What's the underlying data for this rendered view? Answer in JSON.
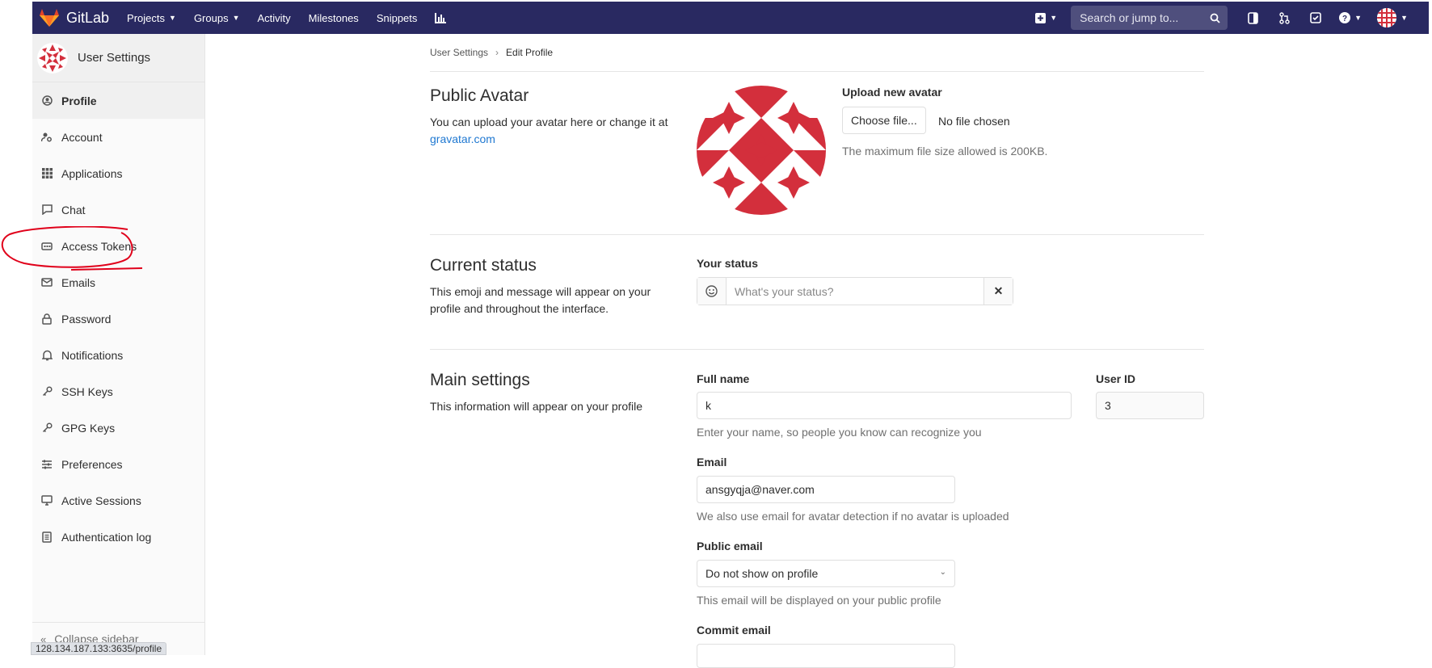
{
  "navbar": {
    "brand": "GitLab",
    "links": [
      {
        "label": "Projects",
        "dropdown": true
      },
      {
        "label": "Groups",
        "dropdown": true
      },
      {
        "label": "Activity"
      },
      {
        "label": "Milestones"
      },
      {
        "label": "Snippets"
      }
    ],
    "search_placeholder": "Search or jump to...",
    "icons": [
      "chart-icon",
      "plus-square-icon",
      "search-icon",
      "sidebar-toggle-icon",
      "merge-request-icon",
      "todo-check-icon",
      "help-icon",
      "avatar"
    ]
  },
  "sidebar": {
    "title": "User Settings",
    "items": [
      {
        "label": "Profile",
        "icon": "user-circle-icon",
        "active": true
      },
      {
        "label": "Account",
        "icon": "user-gear-icon"
      },
      {
        "label": "Applications",
        "icon": "grid-icon"
      },
      {
        "label": "Chat",
        "icon": "speech-bubble-icon"
      },
      {
        "label": "Access Tokens",
        "icon": "token-icon"
      },
      {
        "label": "Emails",
        "icon": "envelope-icon"
      },
      {
        "label": "Password",
        "icon": "lock-icon"
      },
      {
        "label": "Notifications",
        "icon": "bell-icon"
      },
      {
        "label": "SSH Keys",
        "icon": "key-icon"
      },
      {
        "label": "GPG Keys",
        "icon": "key-icon"
      },
      {
        "label": "Preferences",
        "icon": "sliders-icon"
      },
      {
        "label": "Active Sessions",
        "icon": "monitor-icon"
      },
      {
        "label": "Authentication log",
        "icon": "list-icon"
      }
    ],
    "collapse_label": "Collapse sidebar"
  },
  "status_bar_url": "128.134.187.133:3635/profile",
  "breadcrumb": {
    "parent": "User Settings",
    "current": "Edit Profile"
  },
  "avatar_section": {
    "title": "Public Avatar",
    "description": "You can upload your avatar here or change it at",
    "link": "gravatar.com",
    "upload_label": "Upload new avatar",
    "choose_file": "Choose file...",
    "no_file": "No file chosen",
    "max_size_help": "The maximum file size allowed is 200KB."
  },
  "status_section": {
    "title": "Current status",
    "description": "This emoji and message will appear on your profile and throughout the interface.",
    "your_status_label": "Your status",
    "status_placeholder": "What's your status?",
    "clear_glyph": "✕"
  },
  "main_settings": {
    "title": "Main settings",
    "description": "This information will appear on your profile",
    "full_name_label": "Full name",
    "full_name_value": "k",
    "full_name_help": "Enter your name, so people you know can recognize you",
    "user_id_label": "User ID",
    "user_id_value": "3",
    "email_label": "Email",
    "email_value": "ansgyqja@naver.com",
    "email_help": "We also use email for avatar detection if no avatar is uploaded",
    "public_email_label": "Public email",
    "public_email_value": "Do not show on profile",
    "public_email_help": "This email will be displayed on your public profile",
    "commit_email_label": "Commit email"
  },
  "colors": {
    "navbar": "#292961",
    "link": "#1f78d1",
    "avatar_red": "#d32f3c",
    "annotation": "#e0001a"
  }
}
